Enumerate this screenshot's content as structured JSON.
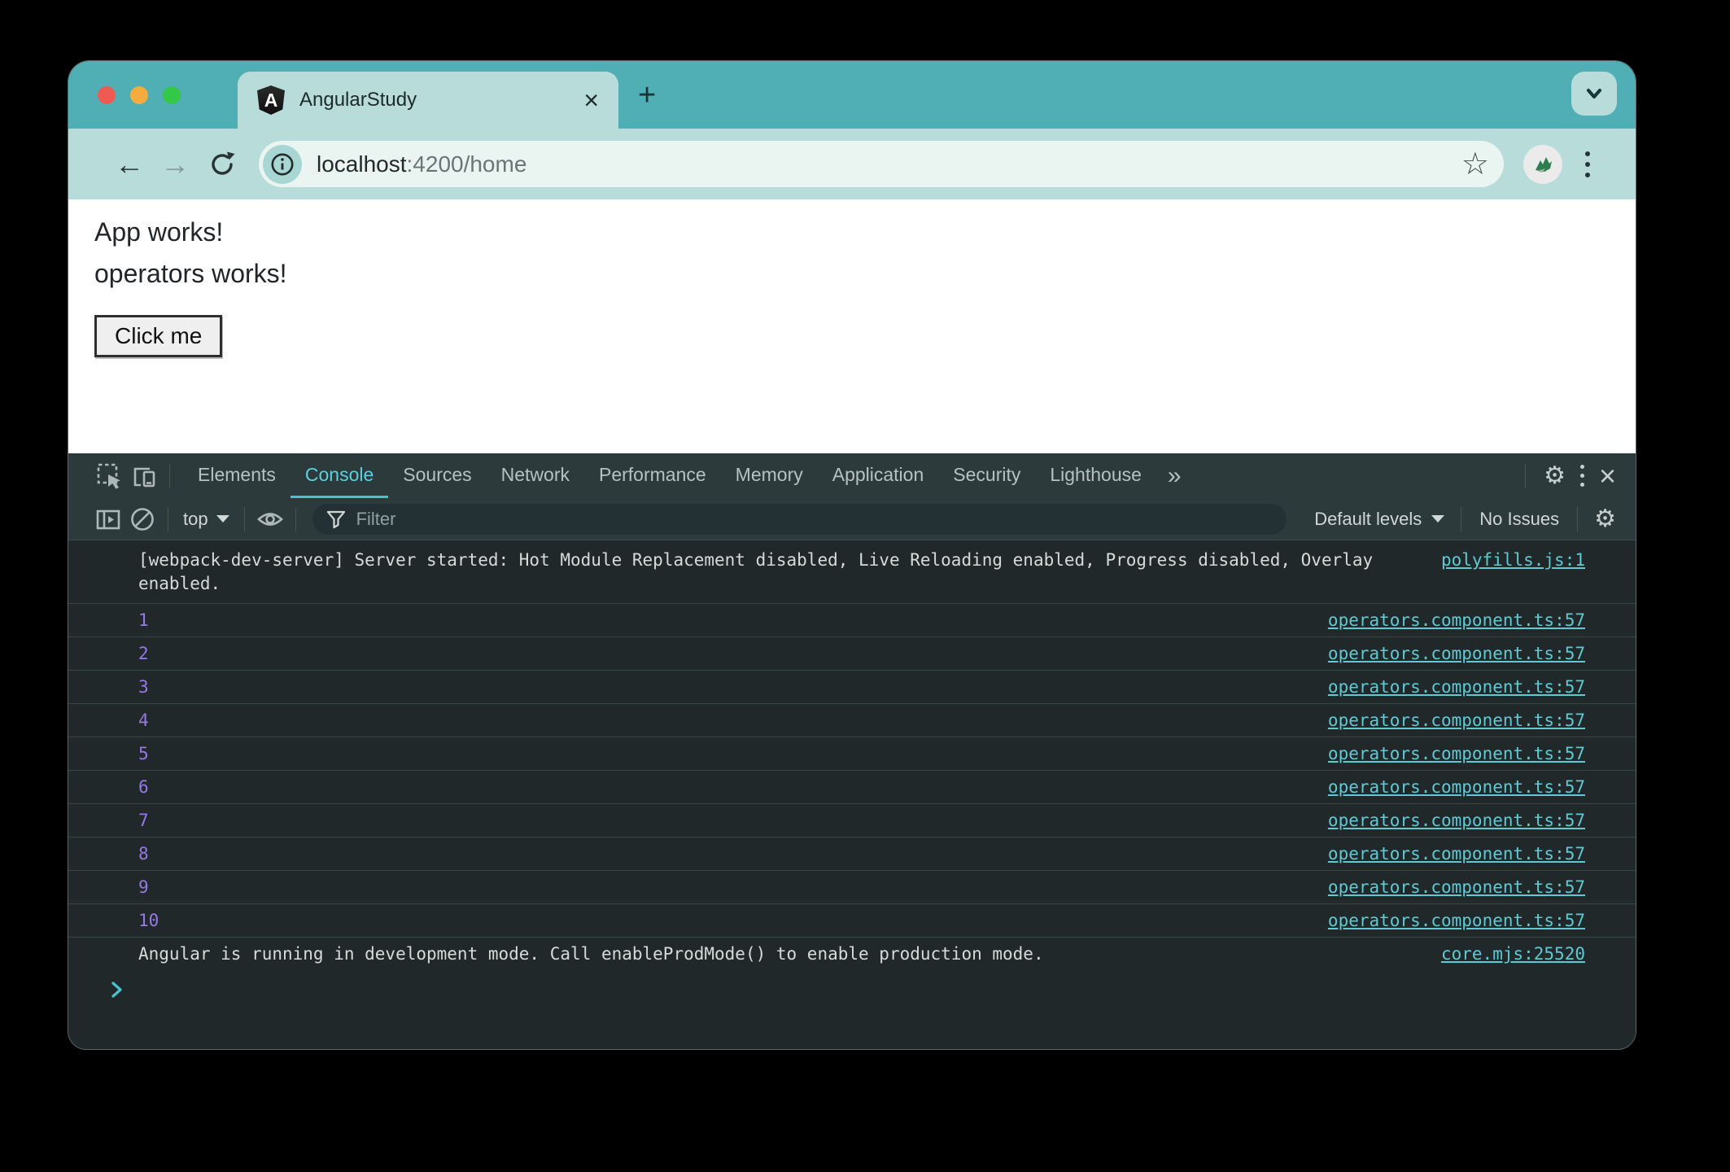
{
  "window": {
    "tab_title": "AngularStudy",
    "url": {
      "host": "localhost",
      "rest": ":4200/home"
    }
  },
  "page": {
    "line1": "App works!",
    "line2": "operators works!",
    "button_label": "Click me"
  },
  "devtools": {
    "tabs": [
      "Elements",
      "Console",
      "Sources",
      "Network",
      "Performance",
      "Memory",
      "Application",
      "Security",
      "Lighthouse"
    ],
    "active_tab": "Console",
    "toolbar": {
      "context_label": "top",
      "filter_placeholder": "Filter",
      "levels_label": "Default levels",
      "issues_label": "No Issues"
    },
    "console": {
      "webpack_message": "[webpack-dev-server] Server started: Hot Module Replacement disabled, Live Reloading enabled, Progress disabled, Overlay enabled.",
      "webpack_link": "polyfills.js:1",
      "rows": [
        {
          "value": "1",
          "link": "operators.component.ts:57"
        },
        {
          "value": "2",
          "link": "operators.component.ts:57"
        },
        {
          "value": "3",
          "link": "operators.component.ts:57"
        },
        {
          "value": "4",
          "link": "operators.component.ts:57"
        },
        {
          "value": "5",
          "link": "operators.component.ts:57"
        },
        {
          "value": "6",
          "link": "operators.component.ts:57"
        },
        {
          "value": "7",
          "link": "operators.component.ts:57"
        },
        {
          "value": "8",
          "link": "operators.component.ts:57"
        },
        {
          "value": "9",
          "link": "operators.component.ts:57"
        },
        {
          "value": "10",
          "link": "operators.component.ts:57"
        }
      ],
      "angular_message": "Angular is running in development mode. Call enableProdMode() to enable production mode.",
      "angular_link": "core.mjs:25520"
    }
  },
  "icons": {
    "close": "×",
    "plus": "+",
    "star": "☆",
    "gear": "⚙",
    "more_tabs": "»",
    "back_arrow": "←",
    "forward_arrow": "→",
    "ng_letter": "A"
  },
  "colors": {
    "chrome_teal": "#4fafb4",
    "chrome_light_teal": "#b7dcda",
    "url_pill": "#eaf4f1",
    "devtools_bar": "#2c3a3c",
    "console_bg": "#212829",
    "console_text": "#d6dbd9",
    "console_link": "#5fc9d4",
    "console_number": "#9579e8",
    "active_tab": "#5cd1dd",
    "traffic_red": "#ef5a52",
    "traffic_yellow": "#f5ab3d",
    "traffic_green": "#34c748"
  }
}
